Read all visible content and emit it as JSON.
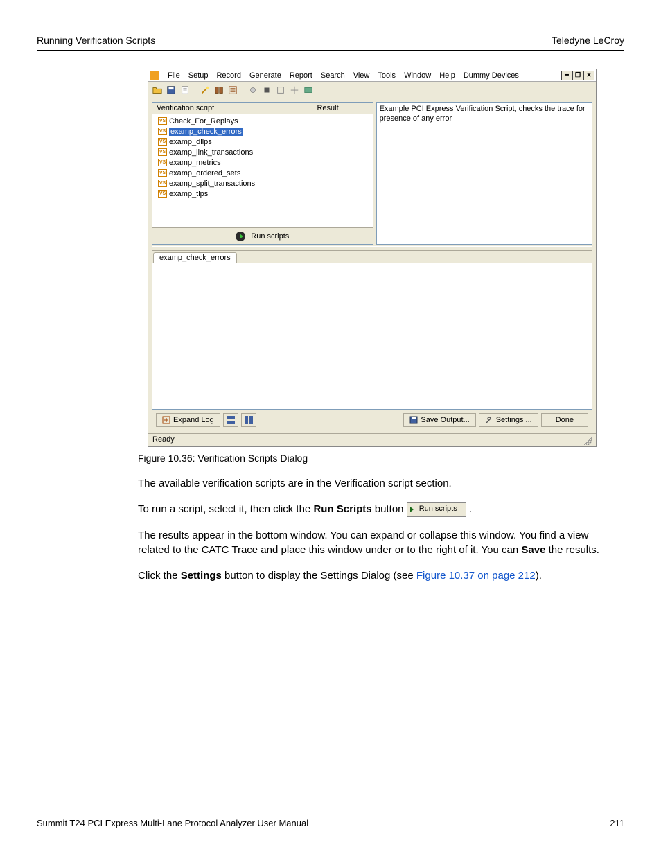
{
  "header": {
    "left": "Running Verification Scripts",
    "right": "Teledyne LeCroy"
  },
  "footer": {
    "left": "Summit T24 PCI Express Multi-Lane Protocol Analyzer User Manual",
    "right": "211"
  },
  "menubar": [
    "File",
    "Setup",
    "Record",
    "Generate",
    "Report",
    "Search",
    "View",
    "Tools",
    "Window",
    "Help",
    "Dummy Devices"
  ],
  "scripts_hdr": {
    "c1": "Verification script",
    "c2": "Result"
  },
  "scripts": [
    {
      "name": "Check_For_Replays",
      "selected": false
    },
    {
      "name": "examp_check_errors",
      "selected": true
    },
    {
      "name": "examp_dllps",
      "selected": false
    },
    {
      "name": "examp_link_transactions",
      "selected": false
    },
    {
      "name": "examp_metrics",
      "selected": false
    },
    {
      "name": "examp_ordered_sets",
      "selected": false
    },
    {
      "name": "examp_split_transactions",
      "selected": false
    },
    {
      "name": "examp_tlps",
      "selected": false
    }
  ],
  "run_scripts_label": "Run scripts",
  "description_text": "Example PCI Express Verification Script, checks the trace for presence of any error",
  "tab_label": "examp_check_errors",
  "bottom_bar": {
    "expand_log": "Expand Log",
    "save_output": "Save Output...",
    "settings": "Settings ...",
    "done": "Done"
  },
  "status_text": "Ready",
  "figure_caption": "Figure 10.36:  Verification Scripts Dialog",
  "para1": "The available verification scripts are in the Verification script section.",
  "para2_a": "To run a script, select it, then click the ",
  "para2_b": "Run Scripts",
  "para2_c": " button ",
  "inline_btn_label": "Run scripts",
  "para3_a": "The results appear in the bottom window. You can expand or collapse this window. You find a view related to the CATC Trace and place this window under or to the right of it. You can ",
  "para3_b": "Save",
  "para3_c": " the results.",
  "para4_a": "Click the ",
  "para4_b": "Settings",
  "para4_c": " button to display the Settings Dialog (see ",
  "para4_link": "Figure 10.37 on page 212",
  "para4_d": ")."
}
